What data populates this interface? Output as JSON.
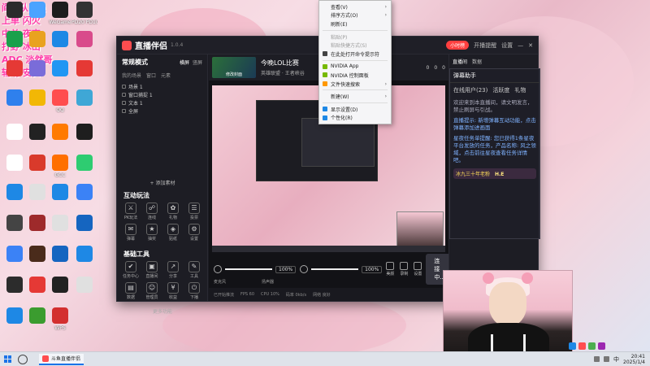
{
  "overlay_text": [
    "阎王队队员",
    "上单 闪火",
    "中单 夜夜",
    "打野 冰山",
    "ADC 淡然哥",
    "辅助 安安"
  ],
  "desktop_icons": [
    {
      "label": "",
      "color": "#2b2b2b"
    },
    {
      "label": "",
      "color": "#4aa3ff"
    },
    {
      "label": "WeGame",
      "color": "#1d1d1d"
    },
    {
      "label": "PD20 PD10",
      "color": "#333"
    },
    {
      "label": "",
      "color": "#1aa04b"
    },
    {
      "label": "",
      "color": "#e9a21f"
    },
    {
      "label": "",
      "color": "#1e88e5"
    },
    {
      "label": "",
      "color": "#d94b8b"
    },
    {
      "label": "",
      "color": "#e53935"
    },
    {
      "label": "",
      "color": "#7a6cd9"
    },
    {
      "label": "",
      "color": "#2196f3"
    },
    {
      "label": "",
      "color": "#e53935"
    },
    {
      "label": "",
      "color": "#2f80ed"
    },
    {
      "label": "",
      "color": "#f2b705"
    },
    {
      "label": "QQ",
      "color": "#ff4d4f"
    },
    {
      "label": "",
      "color": "#3fa7d6"
    },
    {
      "label": "",
      "color": "#ffffff"
    },
    {
      "label": "",
      "color": "#222"
    },
    {
      "label": "",
      "color": "#ff7a00"
    },
    {
      "label": "",
      "color": "#1e1e1e"
    },
    {
      "label": "",
      "color": "#ffffff"
    },
    {
      "label": "",
      "color": "#d93a2b"
    },
    {
      "label": "GCC",
      "color": "#ff6f00"
    },
    {
      "label": "",
      "color": "#2ecc71"
    },
    {
      "label": "",
      "color": "#1e88e5"
    },
    {
      "label": "",
      "color": "#e0e0e0"
    },
    {
      "label": "",
      "color": "#1e88e5"
    },
    {
      "label": "",
      "color": "#3b82f6"
    },
    {
      "label": "",
      "color": "#444"
    },
    {
      "label": "",
      "color": "#9e2a2b"
    },
    {
      "label": "",
      "color": "#e0e0e0"
    },
    {
      "label": "",
      "color": "#1565c0"
    },
    {
      "label": "",
      "color": "#3b82f6"
    },
    {
      "label": "",
      "color": "#4a2b1b"
    },
    {
      "label": "",
      "color": "#1565c0"
    },
    {
      "label": "",
      "color": "#1e88e5"
    },
    {
      "label": "",
      "color": "#2c2c2c"
    },
    {
      "label": "",
      "color": "#e53935"
    },
    {
      "label": "",
      "color": "#222"
    },
    {
      "label": "",
      "color": "#e0e0e0"
    },
    {
      "label": "",
      "color": "#1e88e5"
    },
    {
      "label": "",
      "color": "#3b9c2f"
    },
    {
      "label": "WPS",
      "color": "#d32f2f"
    }
  ],
  "app": {
    "title": "直播伴侣",
    "version": "1.0.4",
    "live_pill": "小时榜",
    "titlebar_buttons": [
      "开播提醒",
      "设置"
    ],
    "left": {
      "mode_title": "常规模式",
      "mode_tabs": [
        "横屏",
        "竖屏"
      ],
      "scene_header": [
        "我的场景",
        "窗口",
        "元素"
      ],
      "scenes": [
        {
          "label": "场景 1"
        },
        {
          "label": "窗口捕捉 1"
        },
        {
          "label": "文本 1"
        },
        {
          "label": "全屏"
        }
      ],
      "add_material": "+ 添加素材",
      "interact_title": "互动玩法",
      "interact_tools": [
        "PK玩法",
        "连线",
        "礼物",
        "投票",
        "弹幕",
        "抽奖",
        "贴纸",
        "设置"
      ],
      "basic_title": "基础工具",
      "basic_tools": [
        "任务中心",
        "直播间",
        "分享",
        "工具",
        "数据",
        "管理员",
        "收益",
        "下播"
      ],
      "more": "更多功能"
    },
    "room": {
      "thumb_label": "修改封面",
      "title": "今晚LOL比赛",
      "sub": "英雄联盟 · 王者峡谷",
      "stats": [
        "0",
        "0",
        "0"
      ]
    },
    "controls": {
      "mic_label": "麦克风",
      "mic_value": "100%",
      "mic_level": 1.0,
      "speaker_label": "扬声器",
      "speaker_value": "100%",
      "speaker_level": 1.0,
      "icons": [
        "美颜",
        "录制",
        "设置"
      ],
      "connect": "连接中..."
    },
    "status": [
      "已开始推流",
      "FPS 60",
      "CPU 10%",
      "码率 0kb/s",
      "网络 良好"
    ],
    "right": {
      "tabs": [
        "直播间",
        "数据"
      ]
    }
  },
  "context_menu": {
    "items": [
      {
        "label": "查看(V)",
        "arrow": true,
        "dim": false,
        "icon": ""
      },
      {
        "label": "排序方式(O)",
        "arrow": true,
        "dim": false,
        "icon": ""
      },
      {
        "label": "刷新(E)",
        "arrow": false,
        "dim": false,
        "icon": ""
      },
      {
        "sep": true
      },
      {
        "label": "粘贴(P)",
        "arrow": false,
        "dim": true,
        "icon": ""
      },
      {
        "label": "粘贴快捷方式(S)",
        "arrow": false,
        "dim": true,
        "icon": ""
      },
      {
        "label": "在此处打开命令提示符",
        "arrow": false,
        "dim": false,
        "icon": "#444"
      },
      {
        "sep": true
      },
      {
        "label": "NVIDIA App",
        "arrow": false,
        "dim": false,
        "icon": "#76b900"
      },
      {
        "label": "NVIDIA 控制面板",
        "arrow": false,
        "dim": false,
        "icon": "#76b900"
      },
      {
        "label": "文件快速搜索",
        "arrow": true,
        "dim": false,
        "icon": "#ff9800"
      },
      {
        "sep": true
      },
      {
        "label": "新建(W)",
        "arrow": true,
        "dim": false,
        "icon": ""
      },
      {
        "sep": true
      },
      {
        "label": "显示设置(D)",
        "arrow": false,
        "dim": false,
        "icon": "#1e88e5"
      },
      {
        "label": "个性化(R)",
        "arrow": false,
        "dim": false,
        "icon": "#1e88e5"
      }
    ]
  },
  "chat": {
    "title": "弹幕助手",
    "tabs": [
      "在线用户(23)",
      "活跃度",
      "礼物"
    ],
    "messages": [
      {
        "text": "欢迎来到本直播间，请文明发言，禁止刷屏与引战。",
        "hl": false
      },
      {
        "text": "直播提示: 新增弹幕互动功能，点击弹幕添加进画面",
        "hl": true
      },
      {
        "text": "星夜任务单提醒: 您已获得1条星夜平台发放的任务，产品名称: 风之领域，点击前往星夜查看任务详情吧。",
        "hl": true
      }
    ],
    "gift_label": "冰九三十年老粉",
    "gift_badge": "H.E"
  },
  "taskbar": {
    "app_label": "斗鱼直播伴侣",
    "ime": "中",
    "time": "20:41",
    "date": "2025/1/4"
  }
}
